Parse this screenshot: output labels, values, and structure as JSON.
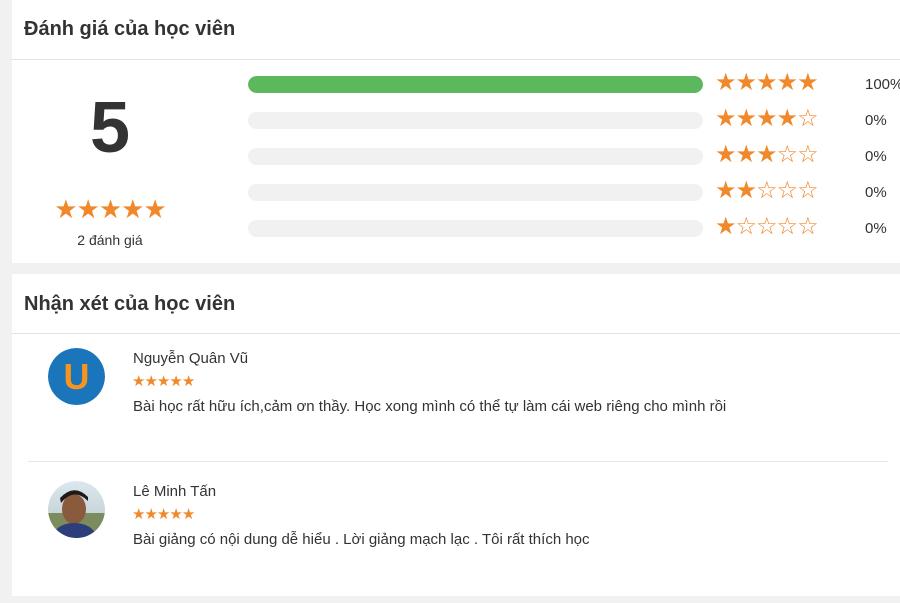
{
  "ratings_section": {
    "title": "Đánh giá của học viên",
    "average": "5",
    "average_stars": 5,
    "count_label": "2 đánh giá",
    "distribution": [
      {
        "stars": 5,
        "fill": 1.0,
        "percent": "100%"
      },
      {
        "stars": 4,
        "fill": 0.0,
        "percent": "0%"
      },
      {
        "stars": 3,
        "fill": 0.0,
        "percent": "0%"
      },
      {
        "stars": 2,
        "fill": 0.0,
        "percent": "0%"
      },
      {
        "stars": 1,
        "fill": 0.0,
        "percent": "0%"
      }
    ]
  },
  "reviews_section": {
    "title": "Nhận xét của học viên",
    "reviews": [
      {
        "name": "Nguyễn Quân Vũ",
        "rating": 5,
        "text": "Bài học rất hữu ích,cảm ơn thầy. Học xong mình có thể tự làm cái web riêng cho mình rồi",
        "avatar": "letter-u-avatar",
        "avatar_letter": "U"
      },
      {
        "name": "Lê Minh Tấn",
        "rating": 5,
        "text": "Bài giảng có nội dung dễ hiểu . Lời giảng mạch lạc . Tôi rất thích học",
        "avatar": "photo-avatar"
      }
    ]
  },
  "colors": {
    "star": "#f0892b",
    "bar_fill": "#5cb85c",
    "bar_track": "#f1f1f1",
    "avatar_u_bg": "#1b75bb",
    "avatar_u_letter": "#f7941d"
  },
  "icons": {
    "full_star": "star-full-icon",
    "empty_star": "star-outline-icon"
  }
}
